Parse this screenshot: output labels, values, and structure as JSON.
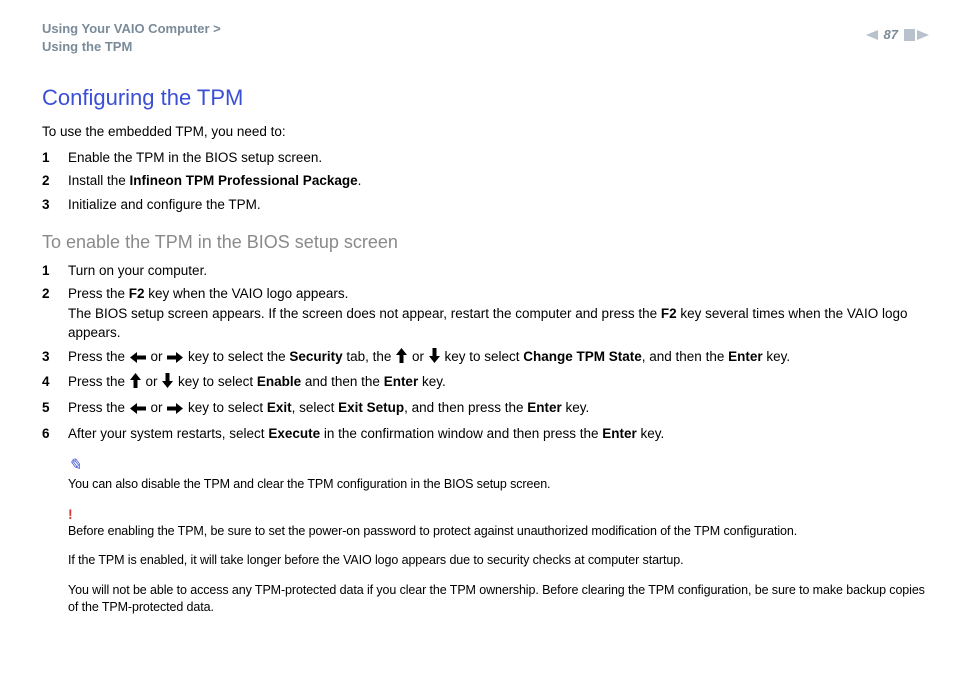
{
  "header": {
    "breadcrumb_line1": "Using Your VAIO Computer >",
    "breadcrumb_line2": "Using the TPM",
    "page_number": "87"
  },
  "title": "Configuring the TPM",
  "intro": "To use the embedded TPM, you need to:",
  "steps_a": {
    "s1": {
      "n": "1",
      "t": "Enable the TPM in the BIOS setup screen."
    },
    "s2": {
      "n": "2",
      "pre": "Install the ",
      "bold": "Infineon TPM Professional Package",
      "post": "."
    },
    "s3": {
      "n": "3",
      "t": "Initialize and configure the TPM."
    }
  },
  "subhead": "To enable the TPM in the BIOS setup screen",
  "steps_b": {
    "s1": {
      "n": "1",
      "t": "Turn on your computer."
    },
    "s2": {
      "n": "2",
      "l1_pre": "Press the ",
      "l1_b1": "F2",
      "l1_post": " key when the VAIO logo appears.",
      "l2_pre": "The BIOS setup screen appears. If the screen does not appear, restart the computer and press the ",
      "l2_b1": "F2",
      "l2_post": " key several times when the VAIO logo appears."
    },
    "s3": {
      "n": "3",
      "a": "Press the ",
      "b": " or ",
      "c": " key to select the ",
      "d": "Security",
      "e": " tab, the ",
      "f": " or ",
      "g": " key to select ",
      "h": "Change TPM State",
      "i": ", and then the ",
      "j": "Enter",
      "k": " key."
    },
    "s4": {
      "n": "4",
      "a": "Press the ",
      "b": " or ",
      "c": " key to select ",
      "d": "Enable",
      "e": " and then the ",
      "f": "Enter",
      "g": " key."
    },
    "s5": {
      "n": "5",
      "a": "Press the ",
      "b": " or ",
      "c": " key to select ",
      "d": "Exit",
      "e": ", select ",
      "f": "Exit Setup",
      "g": ", and then press the ",
      "h": "Enter",
      "i": " key."
    },
    "s6": {
      "n": "6",
      "a": "After your system restarts, select ",
      "b": "Execute",
      "c": " in the confirmation window and then press the ",
      "d": "Enter",
      "e": " key."
    }
  },
  "notes": {
    "pencil": "✎",
    "bang": "!",
    "n1": "You can also disable the TPM and clear the TPM configuration in the BIOS setup screen.",
    "n2": "Before enabling the TPM, be sure to set the power-on password to protect against unauthorized modification of the TPM configuration.",
    "n3": "If the TPM is enabled, it will take longer before the VAIO logo appears due to security checks at computer startup.",
    "n4": "You will not be able to access any TPM-protected data if you clear the TPM ownership. Before clearing the TPM configuration, be sure to make backup copies of the TPM-protected data."
  }
}
